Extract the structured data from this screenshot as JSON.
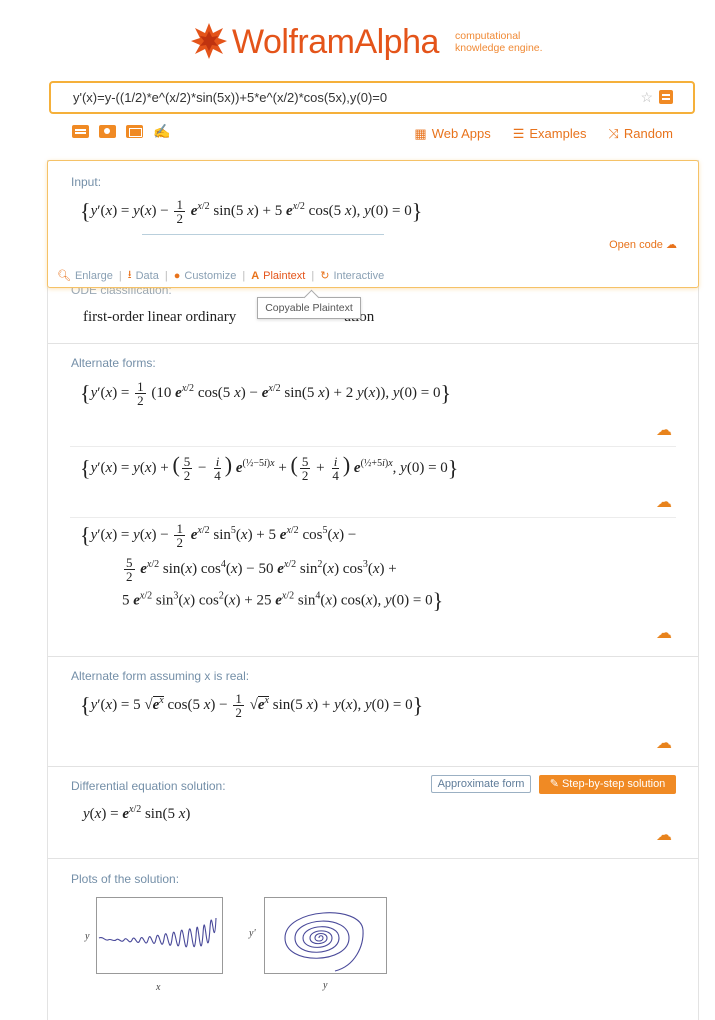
{
  "header": {
    "brand_wolfram": "Wolfram",
    "brand_alpha": "Alpha",
    "tagline_line1": "computational",
    "tagline_line2": "knowledge engine."
  },
  "search": {
    "query": "y'(x)=y-((1/2)*e^(x/2)*sin(5x))+5*e^(x/2)*cos(5x),y(0)=0"
  },
  "nav": {
    "web_apps": "Web Apps",
    "examples": "Examples",
    "random": "Random"
  },
  "input_pod": {
    "title": "Input:",
    "open_code": "Open code",
    "actions": {
      "enlarge": "Enlarge",
      "data": "Data",
      "customize": "Customize",
      "plaintext": "Plaintext",
      "interactive": "Interactive"
    },
    "tooltip": "Copyable Plaintext"
  },
  "ode_pod": {
    "title": "ODE classification:",
    "text_left": "first-order linear ordinary",
    "text_right": "ation"
  },
  "alt_forms": {
    "title": "Alternate forms:"
  },
  "alt_real": {
    "title": "Alternate form assuming x is real:"
  },
  "solution": {
    "title": "Differential equation solution:",
    "approx_btn": "Approximate form",
    "step_btn": "Step-by-step solution"
  },
  "plots": {
    "title": "Plots of the solution:",
    "plot1": {
      "xlabel": "x",
      "ylabel": "y"
    },
    "plot2": {
      "xlabel": "y",
      "ylabel": "y'"
    }
  }
}
